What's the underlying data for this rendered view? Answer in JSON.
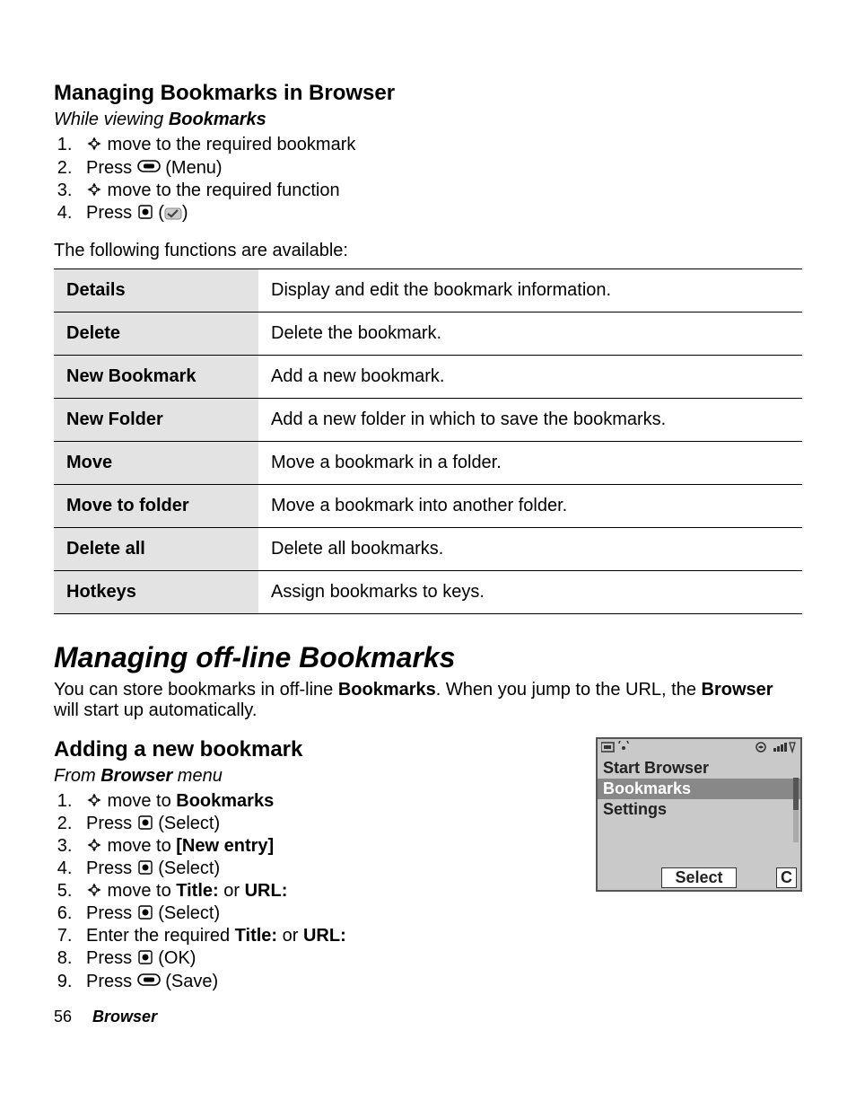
{
  "section1": {
    "title": "Managing Bookmarks in Browser",
    "subhead_prefix": "While viewing ",
    "subhead_bold": "Bookmarks",
    "steps": [
      {
        "type": "nav",
        "text_after": " move to the required bookmark"
      },
      {
        "type": "press_menu",
        "press": "Press ",
        "paren": " (Menu)"
      },
      {
        "type": "nav",
        "text_after": " move to the required function"
      },
      {
        "type": "press_center_check",
        "press": "Press "
      }
    ],
    "intro_para": "The following functions are available:",
    "table": [
      {
        "name": "Details",
        "desc": "Display and edit the bookmark information."
      },
      {
        "name": "Delete",
        "desc": "Delete the bookmark."
      },
      {
        "name": "New Bookmark",
        "desc": "Add a new bookmark."
      },
      {
        "name": "New Folder",
        "desc": "Add a new folder in which to save the bookmarks."
      },
      {
        "name": "Move",
        "desc": "Move a bookmark in a folder."
      },
      {
        "name": "Move to folder",
        "desc": "Move a bookmark into another folder."
      },
      {
        "name": "Delete all",
        "desc": "Delete all bookmarks."
      },
      {
        "name": "Hotkeys",
        "desc": "Assign bookmarks to keys."
      }
    ]
  },
  "section2": {
    "title": "Managing off-line Bookmarks",
    "para_parts": {
      "t1": "You can store bookmarks in off-line ",
      "b1": "Bookmarks",
      "t2": ". When you jump to the URL, the ",
      "b2": "Browser",
      "t3": " will start up automatically."
    }
  },
  "section3": {
    "title": "Adding a new bookmark",
    "subhead_prefix": "From ",
    "subhead_bold": "Browser",
    "subhead_suffix": " menu",
    "steps": [
      {
        "pre": "",
        "icon": "nav",
        "mid": " move to ",
        "bold": "Bookmarks",
        "post": ""
      },
      {
        "pre": "Press ",
        "icon": "center",
        "mid": " (Select)",
        "bold": "",
        "post": ""
      },
      {
        "pre": "",
        "icon": "nav",
        "mid": " move to ",
        "bold": "[New entry]",
        "post": ""
      },
      {
        "pre": "Press ",
        "icon": "center",
        "mid": " (Select)",
        "bold": "",
        "post": ""
      },
      {
        "pre": "",
        "icon": "nav",
        "mid": " move to ",
        "bold": "Title:",
        "post": " or ",
        "bold2": "URL:"
      },
      {
        "pre": "Press ",
        "icon": "center",
        "mid": " (Select)",
        "bold": "",
        "post": ""
      },
      {
        "pre": "Enter the required ",
        "icon": "",
        "mid": "",
        "bold": "Title:",
        "post": " or ",
        "bold2": "URL:"
      },
      {
        "pre": "Press ",
        "icon": "center",
        "mid": " (OK)",
        "bold": "",
        "post": ""
      },
      {
        "pre": "Press ",
        "icon": "menu",
        "mid": " (Save)",
        "bold": "",
        "post": ""
      }
    ]
  },
  "phone": {
    "menu": [
      "Start Browser",
      "Bookmarks",
      "Settings"
    ],
    "highlight_index": 1,
    "softkey_select": "Select",
    "softkey_c": "C"
  },
  "footer": {
    "page": "56",
    "section": "Browser"
  },
  "icons": {
    "nav": "nav-icon",
    "center": "center-icon",
    "menu": "menu-icon",
    "check": "check-icon"
  }
}
